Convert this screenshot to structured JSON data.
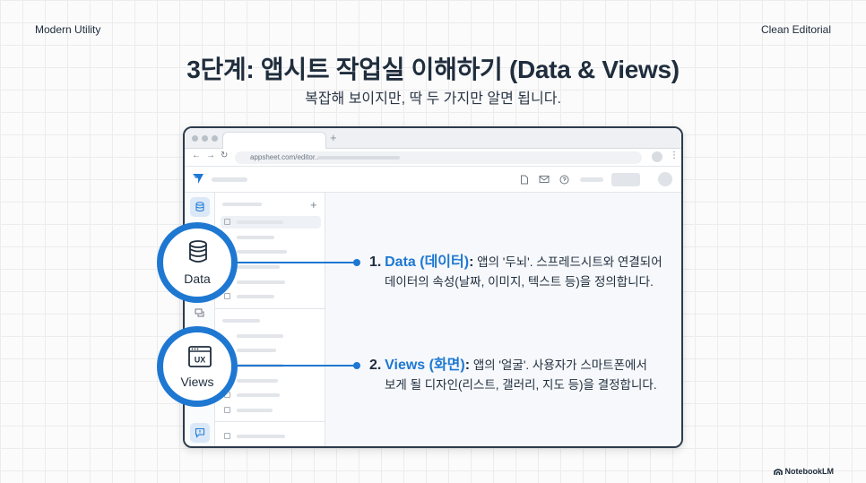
{
  "header": {
    "left_label": "Modern Utility",
    "right_label": "Clean Editorial",
    "title": "3단계: 앱시트 작업실 이해하기 (Data & Views)",
    "subtitle": "복잡해 보이지만, 딱 두 가지만 알면 됩니다."
  },
  "browser": {
    "url": "appsheet.com/editor...",
    "new_tab_symbol": "+"
  },
  "callouts": [
    {
      "badge_label": "Data",
      "icon": "database-icon",
      "number": "1.",
      "term": "Data (데이터)",
      "line1": "앱의 '두뇌'. 스프레드시트와 연결되어",
      "line2": "데이터의 속성(날짜, 이미지, 텍스트 등)을 정의합니다."
    },
    {
      "badge_label": "Views",
      "icon": "ux-window-icon",
      "icon_text": "UX",
      "number": "2.",
      "term": "Views (화면)",
      "line1": "앱의 '얼굴'. 사용자가 스마트폰에서",
      "line2": "보게 될 디자인(리스트, 갤러리, 지도 등)을 결정합니다."
    }
  ],
  "footer": {
    "brand": "NotebookLM"
  },
  "colors": {
    "accent": "#1e78d2",
    "text": "#1f2d3d"
  }
}
